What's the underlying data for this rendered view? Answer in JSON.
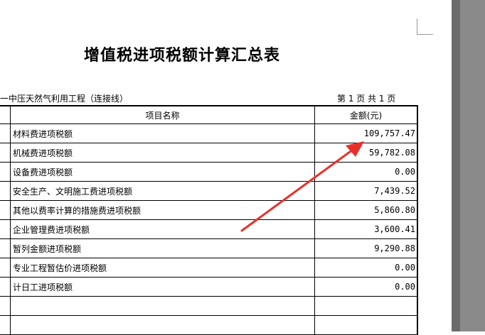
{
  "report": {
    "title": "增值税进项税额计算汇总表",
    "project_name": "一中压天然气利用工程（连接线）",
    "page_info": "第 1 页  共 1 页"
  },
  "table": {
    "headers": [
      "项目名称",
      "金额(元)"
    ],
    "rows": [
      {
        "name": "材料费进项税额",
        "amount": "109,757.47"
      },
      {
        "name": "机械费进项税额",
        "amount": "59,782.08"
      },
      {
        "name": "设备费进项税额",
        "amount": "0.00"
      },
      {
        "name": "安全生产、文明施工费进项税额",
        "amount": "7,439.52"
      },
      {
        "name": "其他以费率计算的措施费进项税额",
        "amount": "5,860.80"
      },
      {
        "name": "企业管理费进项税额",
        "amount": "3,600.41"
      },
      {
        "name": "暂列金额进项税额",
        "amount": "9,290.88"
      },
      {
        "name": "专业工程暂估价进项税额",
        "amount": "0.00"
      },
      {
        "name": "计日工进项税额",
        "amount": "0.00"
      },
      {
        "name": "",
        "amount": ""
      },
      {
        "name": "",
        "amount": ""
      }
    ]
  },
  "annotation": {
    "color": "#e8302a"
  }
}
